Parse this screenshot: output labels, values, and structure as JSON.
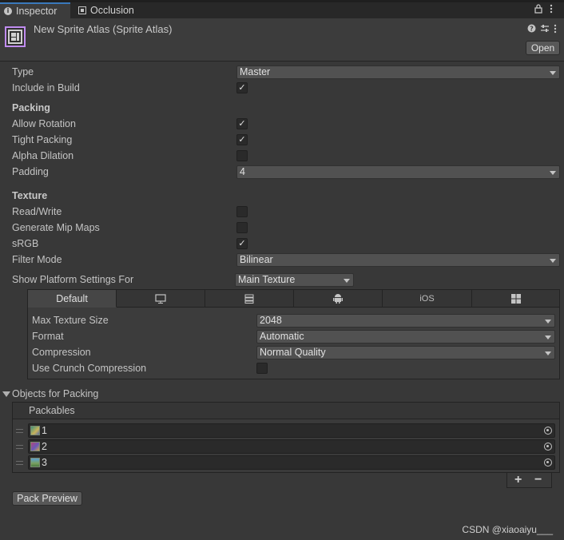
{
  "tabs": {
    "inspector": "Inspector",
    "occlusion": "Occlusion"
  },
  "header": {
    "title": "New Sprite Atlas (Sprite Atlas)",
    "open_button": "Open"
  },
  "fields": {
    "type_label": "Type",
    "type_value": "Master",
    "include_label": "Include in Build",
    "include_checked": true
  },
  "packing": {
    "section": "Packing",
    "allow_rotation_label": "Allow Rotation",
    "allow_rotation": true,
    "tight_packing_label": "Tight Packing",
    "tight_packing": true,
    "alpha_dilation_label": "Alpha Dilation",
    "alpha_dilation": false,
    "padding_label": "Padding",
    "padding_value": "4"
  },
  "texture": {
    "section": "Texture",
    "read_write_label": "Read/Write",
    "read_write": false,
    "mip_label": "Generate Mip Maps",
    "mip": false,
    "srgb_label": "sRGB",
    "srgb": true,
    "filter_label": "Filter Mode",
    "filter_value": "Bilinear"
  },
  "platform": {
    "label": "Show Platform Settings For",
    "value": "Main Texture",
    "tabs": [
      "Default",
      "monitor-icon",
      "server-icon",
      "android-icon",
      "iOS",
      "windows-icon"
    ],
    "ios_label": "iOS",
    "default_label": "Default",
    "max_size_label": "Max Texture Size",
    "max_size_value": "2048",
    "format_label": "Format",
    "format_value": "Automatic",
    "compression_label": "Compression",
    "compression_value": "Normal Quality",
    "crunch_label": "Use Crunch Compression",
    "crunch": false
  },
  "objects": {
    "section": "Objects for Packing",
    "list_header": "Packables",
    "items": [
      {
        "name": "1"
      },
      {
        "name": "2"
      },
      {
        "name": "3"
      }
    ],
    "add": "+",
    "remove": "−"
  },
  "pack_preview": "Pack Preview",
  "watermark": "CSDN @xiaoaiyu___",
  "colors": {
    "accent_tab": "#3a79bb",
    "atlas_icon": "#c08cf0",
    "background": "#383838"
  }
}
